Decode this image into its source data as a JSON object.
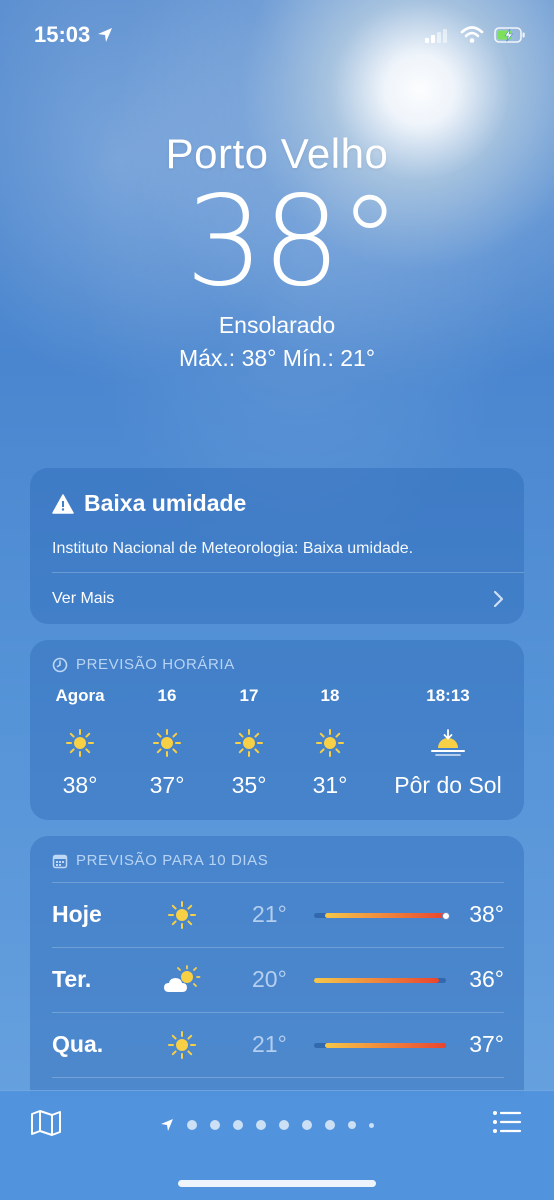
{
  "status_bar": {
    "time": "15:03"
  },
  "location": {
    "city": "Porto Velho",
    "temperature": "38°",
    "condition": "Ensolarado",
    "high_low": "Máx.: 38°  Mín.: 21°"
  },
  "alert": {
    "title": "Baixa umidade",
    "text": "Instituto Nacional de Meteorologia: Baixa umidade.",
    "more": "Ver Mais"
  },
  "hourly": {
    "header": "PREVISÃO HORÁRIA",
    "items": [
      {
        "label": "Agora",
        "icon": "sun-icon",
        "temp": "38°"
      },
      {
        "label": "16",
        "icon": "sun-icon",
        "temp": "37°"
      },
      {
        "label": "17",
        "icon": "sun-icon",
        "temp": "35°"
      },
      {
        "label": "18",
        "icon": "sun-icon",
        "temp": "31°"
      },
      {
        "label": "18:13",
        "icon": "sunset-icon",
        "temp": "Pôr do Sol"
      }
    ]
  },
  "daily": {
    "header": "PREVISÃO PARA 10 DIAS",
    "items": [
      {
        "day": "Hoje",
        "icon": "sun-icon",
        "low": "21°",
        "high": "38°",
        "range_start": 0.08,
        "range_end": 1.0,
        "current_marker": true
      },
      {
        "day": "Ter.",
        "icon": "partly-cloudy-icon",
        "low": "20°",
        "high": "36°",
        "range_start": 0.0,
        "range_end": 0.95,
        "current_marker": false
      },
      {
        "day": "Qua.",
        "icon": "sun-icon",
        "low": "21°",
        "high": "37°",
        "range_start": 0.08,
        "range_end": 1.0,
        "current_marker": false
      }
    ]
  },
  "pager": {
    "page_count": 10,
    "current_index": 0
  },
  "colors": {
    "sun_yellow": "#f7d046",
    "bar_start": "#f5c84a",
    "bar_end": "#e9452f",
    "header_text": "#bed7f5"
  }
}
